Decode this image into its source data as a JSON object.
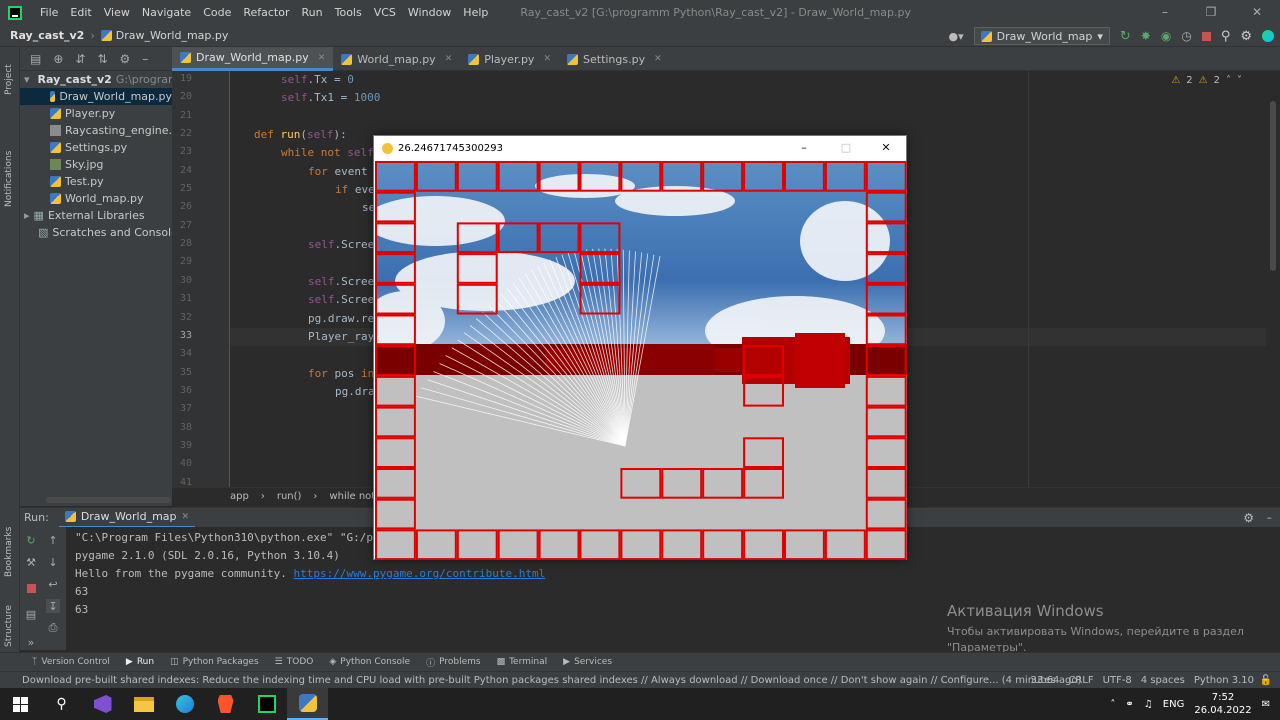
{
  "menu": {
    "items": [
      "File",
      "Edit",
      "View",
      "Navigate",
      "Code",
      "Refactor",
      "Run",
      "Tools",
      "VCS",
      "Window",
      "Help"
    ],
    "window_title": "Ray_cast_v2 [G:\\programm Python\\Ray_cast_v2] - Draw_World_map.py"
  },
  "nav": {
    "project": "Ray_cast_v2",
    "file": "Draw_World_map.py",
    "run_config": "Draw_World_map"
  },
  "sidebar": {
    "project_label": "Project",
    "notifications_label": "Notifications",
    "bookmarks_label": "Bookmarks",
    "structure_label": "Structure"
  },
  "project_tree": {
    "root": "Ray_cast_v2",
    "root_path": "G:\\programm",
    "files": [
      "Draw_World_map.py",
      "Player.py",
      "Raycasting_engine.zip",
      "Settings.py",
      "Sky.jpg",
      "Test.py",
      "World_map.py"
    ],
    "external": "External Libraries",
    "scratches": "Scratches and Consoles"
  },
  "tabs": [
    "Draw_World_map.py",
    "World_map.py",
    "Player.py",
    "Settings.py"
  ],
  "editor": {
    "line_numbers": [
      "19",
      "20",
      "21",
      "22",
      "23",
      "24",
      "25",
      "26",
      "27",
      "28",
      "29",
      "30",
      "31",
      "32",
      "33",
      "34",
      "35",
      "36",
      "37",
      "38",
      "39",
      "40",
      "41"
    ],
    "warnings_a": "2",
    "warnings_b": "2",
    "breadcrumb": [
      "app",
      "run()",
      "while not self.l"
    ]
  },
  "run": {
    "label": "Run:",
    "tab": "Draw_World_map",
    "output": [
      "\"C:\\Program Files\\Python310\\python.exe\" \"G:/p",
      "pygame 2.1.0 (SDL 2.0.16, Python 3.10.4)",
      "Hello from the pygame community. ",
      "63",
      "63"
    ],
    "link": "https://www.pygame.org/contribute.html"
  },
  "watermark": {
    "title": "Активация Windows",
    "body": "Чтобы активировать Windows, перейдите в раздел \"Параметры\"."
  },
  "tool_tabs": [
    "Version Control",
    "Run",
    "Python Packages",
    "TODO",
    "Python Console",
    "Problems",
    "Terminal",
    "Services"
  ],
  "status": {
    "message": "Download pre-built shared indexes: Reduce the indexing time and CPU load with pre-built Python packages shared indexes // Always download // Download once // Don't show again // Configure... (4 minutes ago)",
    "position": "33:64",
    "line_sep": "CRLF",
    "encoding": "UTF-8",
    "indent": "4 spaces",
    "interpreter": "Python 3.10"
  },
  "taskbar": {
    "lang": "ENG",
    "time": "7:52",
    "date": "26.04.2022"
  },
  "pygame_window": {
    "title": "26.24671745300293"
  },
  "colors": {
    "accent": "#4a88c7",
    "wall_red": "#e00000",
    "wall_dark": "#8b0000",
    "floor": "#c0c0c0"
  }
}
